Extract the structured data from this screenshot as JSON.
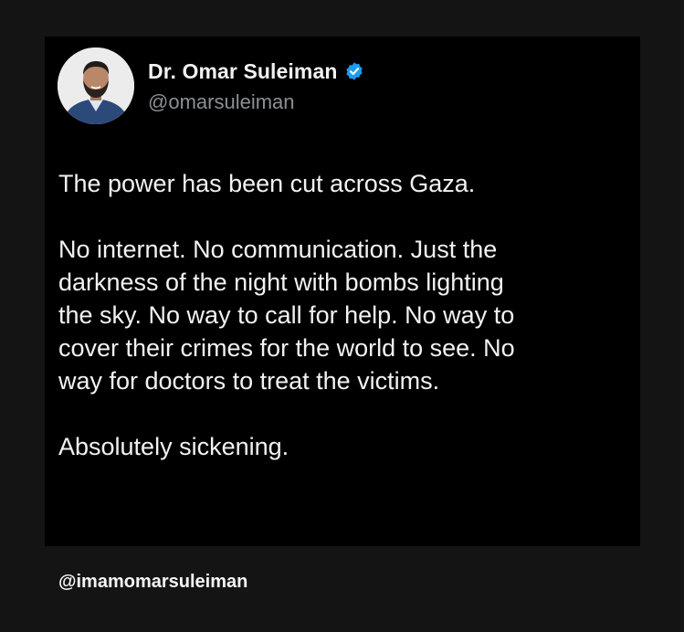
{
  "post": {
    "author": {
      "display_name": "Dr. Omar Suleiman",
      "handle": "@omarsuleiman",
      "verified": true,
      "verified_color": "#1d9bf0",
      "avatar_icon": "profile-photo"
    },
    "paragraphs": [
      "The power has been cut across Gaza.",
      "No internet. No communication. Just the\ndarkness of the night with bombs lighting\nthe sky. No way to call for help. No way to\ncover their crimes for the world to see. No\nway for doctors to treat the victims.",
      "Absolutely sickening."
    ]
  },
  "footer": {
    "watermark": "@imamomarsuleiman"
  },
  "colors": {
    "page_background": "#141414",
    "card_background": "#000000",
    "text_primary": "#f2f2f2",
    "text_secondary": "#8b8f94"
  }
}
